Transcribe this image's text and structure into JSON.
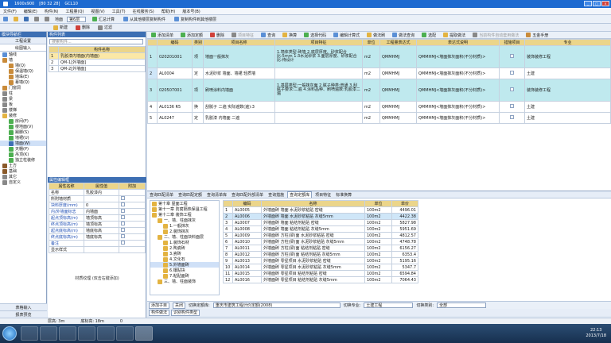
{
  "window": {
    "title": "GCL10",
    "title_extra1": "1600x900",
    "title_extra2": "[80 32 28]"
  },
  "menu": [
    "文件(F)",
    "编辑(E)",
    "构件(N)",
    "工程量(Q)",
    "视图(V)",
    "工具(T)",
    "在线服务(S)",
    "帮助(H)",
    "版本号(B)"
  ],
  "toolbar1": {
    "floor_label": "地面",
    "floor_value": "第6层",
    "items": [
      "汇总计算",
      "从其他楼层复制构件",
      "复制构件到其他楼层"
    ]
  },
  "toolbar2": {
    "items": [
      "新建",
      "删除",
      "过滤"
    ]
  },
  "left_panel": {
    "header": "模块导航栏",
    "title": "工程设置",
    "tab": "绘图输入",
    "tree": [
      "轴线",
      "墙",
      "墙(Q)",
      "保温墙(Q)",
      "墙垛(E)",
      "幕墙(Q)",
      "门窗洞",
      "柱",
      "梁",
      "板",
      "楼梯",
      "装修",
      "房间(F)",
      "楼地面(V)",
      "踢脚(S)",
      "墙裙(U)",
      "墙面(W)",
      "天棚(P)",
      "吊顶(K)",
      "独立柱装修",
      "土方",
      "基础",
      "其它",
      "自定义"
    ],
    "bottom": [
      "表格输入",
      "报表预览"
    ]
  },
  "component_list": {
    "header": "构件列表",
    "search_placeholder": "搜索构件...",
    "col": "构件名称",
    "rows": [
      {
        "no": "1",
        "name": "乳胶漆内墙面(内墙面)"
      },
      {
        "no": "2",
        "name": "QM-1[外墙面]"
      },
      {
        "no": "3",
        "name": "QM-2[外墙面]"
      }
    ]
  },
  "properties": {
    "header": "属性编辑框",
    "cols": [
      "属性名称",
      "属性值",
      "附加"
    ],
    "rows": [
      {
        "name": "名称",
        "value": "乳胶漆内"
      },
      {
        "name": "所附墙材质",
        "value": ""
      },
      {
        "name": "块料厚度(mm)",
        "value": "0"
      },
      {
        "name": "内/外墙面标志",
        "value": "内墙面"
      },
      {
        "name": "起点顶标高(m)",
        "value": "墙顶标高"
      },
      {
        "name": "终点顶标高(m)",
        "value": "墙顶标高"
      },
      {
        "name": "起点底标高(m)",
        "value": "墙底标高"
      },
      {
        "name": "终点底标高(m)",
        "value": "墙底标高"
      },
      {
        "name": "备注",
        "value": ""
      },
      {
        "name": "显示样式",
        "value": ""
      }
    ],
    "footer": "材质纹理 (双击右键添加)"
  },
  "main_toolbar": [
    "添加清单",
    "添加定额",
    "删除",
    "项目特征",
    "查询",
    "换算",
    "选择代码",
    "编辑计算式",
    "做法刷",
    "做法查询",
    "选配",
    "提取做法",
    "当前构件自动套用做法",
    "五金手册"
  ],
  "main_grid": {
    "cols": [
      "编码",
      "类别",
      "项目名称",
      "项目特征",
      "单位",
      "工程量表达式",
      "表达式说明",
      "措施项目",
      "专业"
    ],
    "rows": [
      {
        "no": "1",
        "code": "020201001",
        "type": "项",
        "name": "墙面一般抹灰",
        "feature": "1.墙体类型:砖墙 2.底层厚度、砂浆配合比:5mm 1:3水泥砂浆 3.面层厚度、砂浆配合比:待设计",
        "unit": "m2",
        "expr": "QMMHMJ",
        "desc": "QMMHMJ<墙面抹灰面积(不分材质)>",
        "spec": "装饰装修工程",
        "teal": true
      },
      {
        "no": "2",
        "code": "AL0004",
        "type": "定",
        "name": "水泥砂浆 墙面、墙裙 轻质墙",
        "feature": "",
        "unit": "m2",
        "expr": "QMMHMJ",
        "desc": "QMMHMJ<墙面抹灰面积(不分材质)>",
        "spec": "土建",
        "teal": false
      },
      {
        "no": "3",
        "code": "020507001",
        "type": "项",
        "name": "刷喷涂料内墙面",
        "feature": "1.基层类型:一般抹灰面 2.腻子种类:普通 3.刮腻子要求:二遍 4.涂料品种、刷喷遍数:乳胶漆二遍",
        "unit": "m2",
        "expr": "QMMHMJ",
        "desc": "QMMHMJ<墙面抹灰面积(不分材质)>",
        "spec": "装饰装修工程",
        "teal": true
      },
      {
        "no": "4",
        "code": "AL0136 R5",
        "type": "换",
        "name": "刮腻子 二遍 实际遍数(遍):3",
        "feature": "",
        "unit": "m2",
        "expr": "QMMHMJ",
        "desc": "QMMHMJ<墙面抹灰面积(不分材质)>",
        "spec": "土建",
        "teal": false
      },
      {
        "no": "5",
        "code": "AL0247",
        "type": "定",
        "name": "乳胶漆 内墙面 二遍",
        "feature": "",
        "unit": "m2",
        "expr": "QMMHMJ",
        "desc": "QMMHMJ<墙面抹灰面积(不分材质)>",
        "spec": "土建",
        "teal": false
      }
    ]
  },
  "lower_tabs": [
    "查询匹配清单",
    "查询匹配定额",
    "查询清单库",
    "查询匹配外部清单",
    "查询措施",
    "查询定额库",
    "项目特征",
    "标准换算"
  ],
  "lower_tree": [
    "第十章 屋面工程",
    "第十一章 防腐隔热保温工程",
    "第十二章 装饰工程",
    "一、墙、柱面抹灰",
    "1.一般抹灰",
    "2.装饰抹灰",
    "二、墙、柱面块料面层",
    "1.装饰石材",
    "2.陶瓷砖",
    "3.瓷砖",
    "4.文化石",
    "5.外墙面砖",
    "6.镶贴块",
    "7.粘贴面砖",
    "三、墙、柱面装饰"
  ],
  "quota_table": {
    "cols": [
      "编码",
      "名称",
      "单位",
      "单价"
    ],
    "rows": [
      {
        "no": "1",
        "code": "AL0005",
        "name": "外墙面砖 墙面 水泥砂浆粘贴 密缝",
        "unit": "100m2",
        "price": "4496.01"
      },
      {
        "no": "2",
        "code": "AL0006",
        "name": "外墙面砖 墙面 水泥砂浆粘贴 灰缝5mm",
        "unit": "100m2",
        "price": "4422.38"
      },
      {
        "no": "3",
        "code": "AL0007",
        "name": "外墙面砖 墙面 粘结剂粘贴 密缝",
        "unit": "100m2",
        "price": "5827.98"
      },
      {
        "no": "4",
        "code": "AL0008",
        "name": "外墙面砖 墙面 粘结剂粘贴 灰缝5mm",
        "unit": "100m2",
        "price": "5951.69"
      },
      {
        "no": "5",
        "code": "AL0009",
        "name": "外墙面砖 方柱(梁)面 水泥砂浆粘贴 密缝",
        "unit": "100m2",
        "price": "4812.57"
      },
      {
        "no": "6",
        "code": "AL0010",
        "name": "外墙面砖 方柱(梁)面 水泥砂浆粘贴 灰缝5mm",
        "unit": "100m2",
        "price": "4748.78"
      },
      {
        "no": "7",
        "code": "AL0011",
        "name": "外墙面砖 方柱(梁)面 粘结剂粘贴 密缝",
        "unit": "100m2",
        "price": "6156.27"
      },
      {
        "no": "8",
        "code": "AL0012",
        "name": "外墙面砖 方柱(梁)面 粘结剂粘贴 灰缝5mm",
        "unit": "100m2",
        "price": "6353.4"
      },
      {
        "no": "9",
        "code": "AL0013",
        "name": "外墙面砖 零星项目 水泥砂浆粘贴 密缝",
        "unit": "100m2",
        "price": "5195.16"
      },
      {
        "no": "10",
        "code": "AL0014",
        "name": "外墙面砖 零星项目 水泥砂浆粘贴 灰缝5mm",
        "unit": "100m2",
        "price": "5347.7"
      },
      {
        "no": "11",
        "code": "AL0015",
        "name": "外墙面砖 零星项目 粘结剂粘贴 密缝",
        "unit": "100m2",
        "price": "6594.84"
      },
      {
        "no": "12",
        "code": "AL0016",
        "name": "外墙面砖 零星项目 粘结剂粘贴 灰缝5mm",
        "unit": "100m2",
        "price": "7064.43"
      }
    ]
  },
  "filter_bar": {
    "add_sub": "添加子目",
    "close": "关闭",
    "lib_label": "切换定额库:",
    "lib_value": "重庆市建筑工程计价定额(2008)",
    "spec_label": "切换专业:",
    "spec_value": "土建工程",
    "chapter_label": "切换类别:",
    "chapter_value": "全部"
  },
  "prop_tabs": [
    "构件做法",
    "识别构件类型"
  ],
  "status": {
    "floor": "层高: 3m",
    "base": "底标高: 18m",
    "count": "0"
  },
  "clock": {
    "time": "22:13",
    "date": "2013/7/18"
  }
}
